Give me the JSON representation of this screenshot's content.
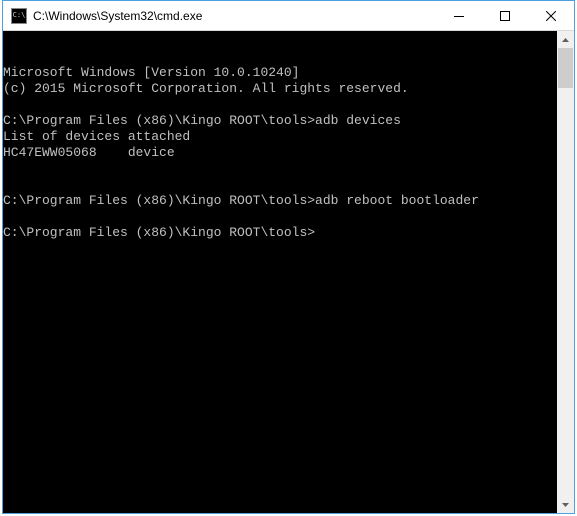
{
  "window": {
    "title": "C:\\Windows\\System32\\cmd.exe",
    "icon_glyph": "C:\\"
  },
  "terminal": {
    "lines": [
      "Microsoft Windows [Version 10.0.10240]",
      "(c) 2015 Microsoft Corporation. All rights reserved.",
      "",
      "C:\\Program Files (x86)\\Kingo ROOT\\tools>adb devices",
      "List of devices attached",
      "HC47EWW05068    device",
      "",
      "",
      "C:\\Program Files (x86)\\Kingo ROOT\\tools>adb reboot bootloader",
      "",
      "C:\\Program Files (x86)\\Kingo ROOT\\tools>"
    ]
  }
}
